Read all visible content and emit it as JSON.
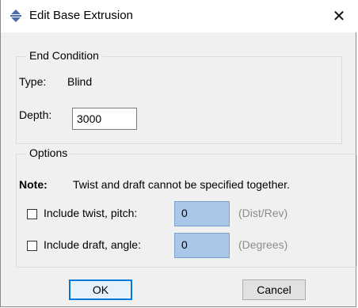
{
  "window": {
    "title": "Edit Base Extrusion",
    "icon": "diamond-arrows-icon",
    "close_glyph": "✕"
  },
  "end_condition": {
    "legend": "End Condition",
    "type_label": "Type:",
    "type_value": "Blind",
    "depth_label": "Depth:",
    "depth_value": "3000"
  },
  "options": {
    "legend": "Options",
    "note_label": "Note:",
    "note_text": "Twist and draft cannot be specified together.",
    "twist": {
      "label": "Include twist, pitch:",
      "checked": false,
      "value": "0",
      "unit": "(Dist/Rev)"
    },
    "draft": {
      "label": "Include draft, angle:",
      "checked": false,
      "value": "0",
      "unit": "(Degrees)"
    }
  },
  "buttons": {
    "ok": "OK",
    "cancel": "Cancel"
  },
  "colors": {
    "accent": "#0078d7",
    "field_highlight": "#a9c8e9",
    "dialog_bg": "#f0f0f0"
  }
}
